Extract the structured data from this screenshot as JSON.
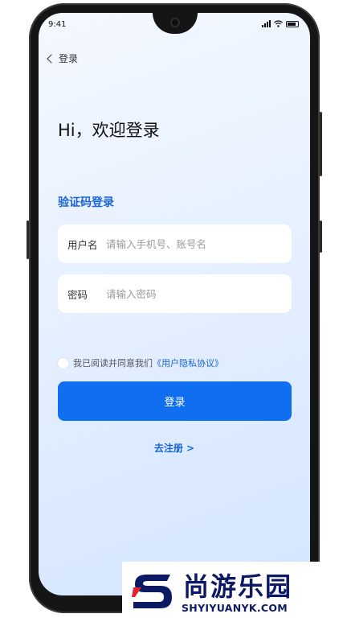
{
  "status_bar": {
    "time": "9:41"
  },
  "nav": {
    "back_label": "登录"
  },
  "greeting": "Hi，欢迎登录",
  "mode_title": "验证码登录",
  "form": {
    "username": {
      "label": "用户名",
      "placeholder": "请输入手机号、账号名",
      "value": ""
    },
    "password": {
      "label": "密码",
      "placeholder": "请输入密码",
      "value": ""
    }
  },
  "agreement": {
    "text": "我已阅读并同意我们",
    "link": "《用户隐私协议》",
    "checked": false
  },
  "login_button": "登录",
  "register_link": "去注册 >",
  "watermark": {
    "cn": "尚游乐园",
    "en": "SHYIYUANYK.COM"
  },
  "colors": {
    "accent": "#0f6ff0",
    "link": "#1a63d8",
    "watermark": "#0c1a63",
    "watermark_red": "#e0242a"
  }
}
